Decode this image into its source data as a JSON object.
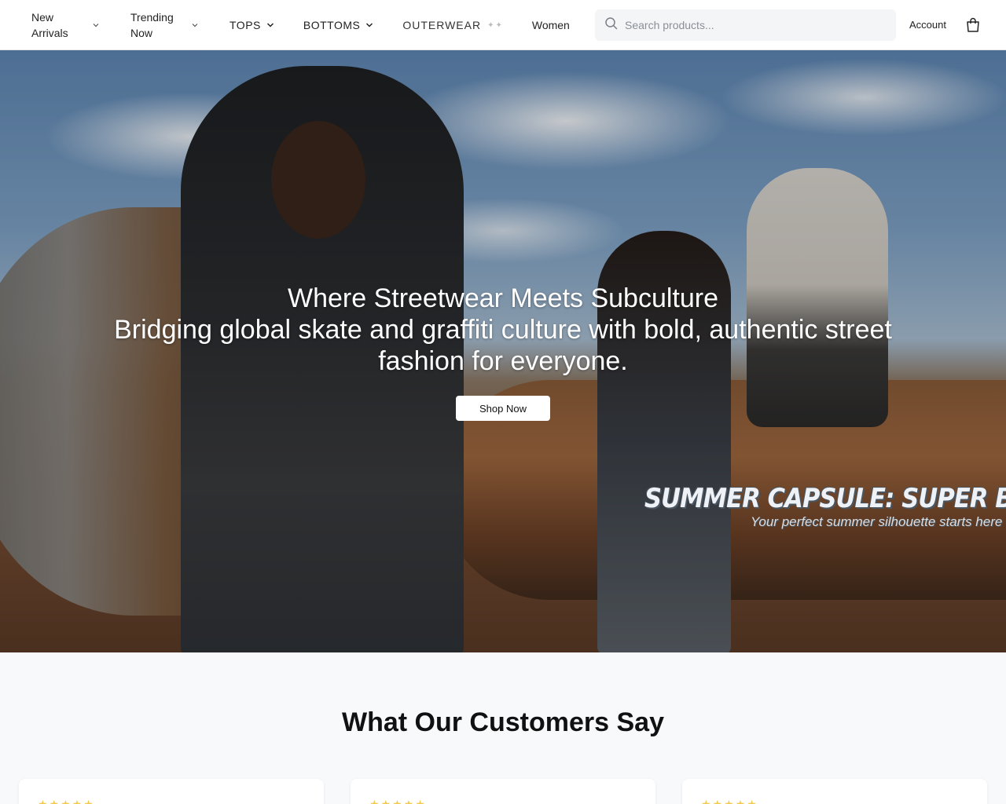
{
  "nav": {
    "items": [
      {
        "label": "New Arrivals",
        "has_dropdown": true
      },
      {
        "label": "Trending Now",
        "has_dropdown": true
      },
      {
        "label": "TOPS",
        "has_dropdown": true
      },
      {
        "label": "BOTTOMS",
        "has_dropdown": true
      },
      {
        "label": "OUTERWEAR",
        "has_dropdown": false
      },
      {
        "label": "Women",
        "has_dropdown": false
      }
    ]
  },
  "search": {
    "placeholder": "Search products..."
  },
  "header": {
    "account_label": "Account",
    "cart_icon": "shopping-bag-icon"
  },
  "hero": {
    "title": "Where Streetwear Meets Subculture",
    "subtitle": "Bridging global skate and graffiti culture with bold, authentic street fashion for everyone.",
    "cta_label": "Shop Now",
    "capsule_title": "SUMMER CAPSULE: SUPER BOX",
    "capsule_subtitle": "Your perfect summer silhouette starts here"
  },
  "reviews": {
    "title": "What Our Customers Say",
    "cards": [
      {
        "stars": "★★★★★"
      },
      {
        "stars": "★★★★★"
      },
      {
        "stars": "★★★★★"
      }
    ]
  },
  "colors": {
    "accent_star": "#f2c94c",
    "nav_text": "#222222"
  }
}
